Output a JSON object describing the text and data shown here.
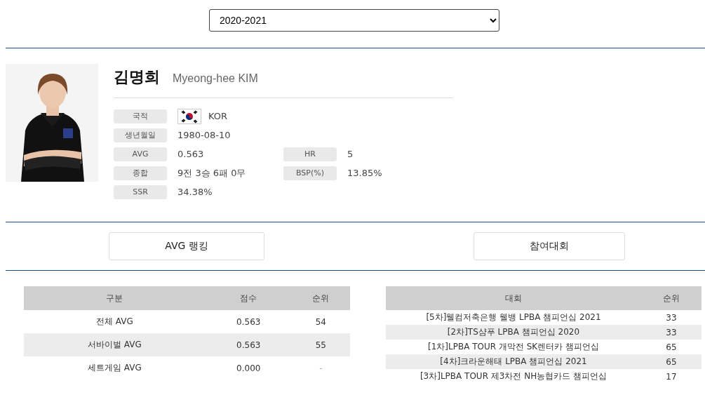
{
  "season_select": {
    "value": "2020-2021"
  },
  "player": {
    "name_ko": "김명희",
    "name_en": "Myeong-hee KIM"
  },
  "info_rows": [
    [
      {
        "label": "국적",
        "value": "KOR",
        "kind": "flag"
      }
    ],
    [
      {
        "label": "생년월일",
        "value": "1980-08-10",
        "kind": "text"
      }
    ],
    [
      {
        "label": "AVG",
        "value": "0.563",
        "kind": "text"
      },
      {
        "label": "HR",
        "value": "5",
        "kind": "text"
      }
    ],
    [
      {
        "label": "종합",
        "value": "9전 3승 6패 0무",
        "kind": "text"
      },
      {
        "label": "BSP(%)",
        "value": "13.85%",
        "kind": "text"
      }
    ],
    [
      {
        "label": "SSR",
        "value": "34.38%",
        "kind": "text"
      }
    ]
  ],
  "sections": [
    {
      "title": "AVG 랭킹",
      "table": {
        "columns": [
          "구분",
          "점수",
          "순위"
        ],
        "rows": [
          [
            "전체 AVG",
            "0.563",
            "54"
          ],
          [
            "서바이벌 AVG",
            "0.563",
            "55"
          ],
          [
            "세트게임 AVG",
            "0.000",
            "-"
          ]
        ]
      }
    },
    {
      "title": "참여대회",
      "table": {
        "columns": [
          "대회",
          "순위"
        ],
        "rows": [
          [
            "[5차]웰컴저축은행 웰뱅 LPBA 챔피언십 2021",
            "33"
          ],
          [
            "[2차]TS샴푸 LPBA 챔피언십 2020",
            "33"
          ],
          [
            "[1차]LPBA TOUR 개막전 SK렌터카 챔피언십",
            "65"
          ],
          [
            "[4차]크라운해태 LPBA 챔피언십 2021",
            "65"
          ],
          [
            "[3차]LPBA TOUR 제3차전 NH농협카드 챔피언십",
            "17"
          ]
        ]
      }
    }
  ]
}
